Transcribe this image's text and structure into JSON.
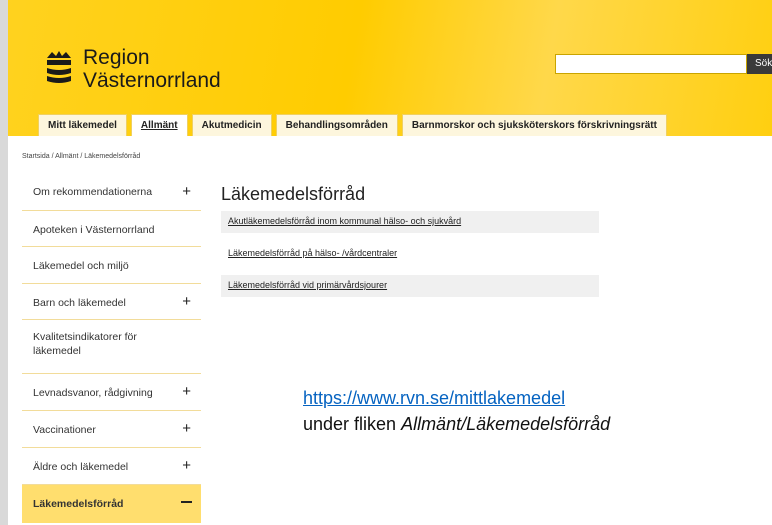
{
  "header": {
    "brand_line1": "Region",
    "brand_line2": "Västernorrland",
    "logo_icon": "region-logo-icon",
    "search_placeholder": "",
    "search_button": "Sök",
    "accent_color": "#ffcc00"
  },
  "tabs": [
    {
      "label": "Mitt läkemedel",
      "active": false
    },
    {
      "label": "Allmänt",
      "active": true
    },
    {
      "label": "Akutmedicin",
      "active": false
    },
    {
      "label": "Behandlingsområden",
      "active": false
    },
    {
      "label": "Barnmorskor och sjuksköterskors förskrivningsrätt",
      "active": false
    }
  ],
  "breadcrumb": "Startsida / Allmänt / Läkemedelsförråd",
  "sidebar": {
    "items": [
      {
        "label": "Om rekommendationerna",
        "expander": "+"
      },
      {
        "label": "Apoteken i Västernorrland",
        "expander": ""
      },
      {
        "label": "Läkemedel och miljö",
        "expander": ""
      },
      {
        "label": "Barn och läkemedel",
        "expander": "+"
      },
      {
        "label": "Kvalitetsindikatorer för läkemedel",
        "expander": ""
      },
      {
        "label": "Levnadsvanor, rådgivning",
        "expander": "+"
      },
      {
        "label": "Vaccinationer",
        "expander": "+"
      },
      {
        "label": "Äldre och läkemedel",
        "expander": "+"
      },
      {
        "label": "Läkemedelsförråd",
        "expander": "−"
      }
    ]
  },
  "main": {
    "title": "Läkemedelsförråd",
    "links": [
      "Akutläkemedelsförråd inom kommunal hälso- och sjukvård",
      "Läkemedelsförråd på hälso-  /vårdcentraler",
      "Läkemedelsförråd vid primärvårdsjourer"
    ]
  },
  "annotation": {
    "url": "https://www.rvn.se/mittlakemedel",
    "caption_prefix": "under fliken ",
    "caption_italic": "Allmänt/Läkemedelsförråd"
  }
}
